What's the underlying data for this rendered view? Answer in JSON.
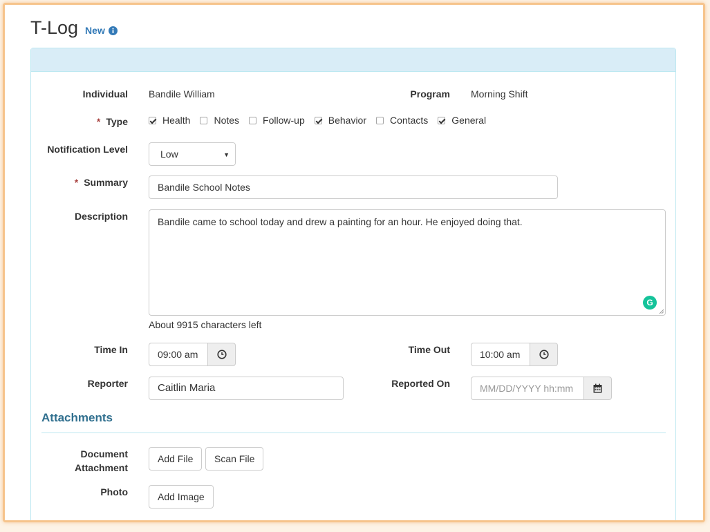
{
  "page": {
    "title": "T-Log",
    "badge": "New"
  },
  "form": {
    "individual": {
      "label": "Individual",
      "value": "Bandile William"
    },
    "program": {
      "label": "Program",
      "value": "Morning Shift"
    },
    "type": {
      "label": "Type",
      "required_mark": "*",
      "options": [
        {
          "label": "Health",
          "checked": true
        },
        {
          "label": "Notes",
          "checked": false
        },
        {
          "label": "Follow-up",
          "checked": false
        },
        {
          "label": "Behavior",
          "checked": true
        },
        {
          "label": "Contacts",
          "checked": false
        },
        {
          "label": "General",
          "checked": true
        }
      ]
    },
    "notification_level": {
      "label": "Notification Level",
      "value": "Low"
    },
    "summary": {
      "label": "Summary",
      "required_mark": "*",
      "value": "Bandile School Notes"
    },
    "description": {
      "label": "Description",
      "value": "Bandile came to school today and drew a painting for an hour. He enjoyed doing that.",
      "help": "About 9915 characters left",
      "grammarly_letter": "G"
    },
    "time_in": {
      "label": "Time In",
      "value": "09:00 am"
    },
    "time_out": {
      "label": "Time Out",
      "value": "10:00 am"
    },
    "reporter": {
      "label": "Reporter",
      "value": "Caitlin Maria"
    },
    "reported_on": {
      "label": "Reported On",
      "placeholder": "MM/DD/YYYY hh:mm"
    }
  },
  "attachments": {
    "title": "Attachments",
    "document": {
      "label_line1": "Document",
      "label_line2": "Attachment",
      "add_file": "Add File",
      "scan_file": "Scan File"
    },
    "photo": {
      "label": "Photo",
      "add_image": "Add Image"
    }
  },
  "colors": {
    "accent": "#337ab7",
    "section_title": "#31708f",
    "panel_heading": "#d9edf7",
    "required": "#a94442",
    "frame_border": "#f6c48c",
    "grammarly": "#15c39a"
  },
  "icons": {
    "badge": "info-circle-icon",
    "time": "clock-icon",
    "date": "calendar-icon",
    "grammarly": "grammarly-icon",
    "resize": "resize-grip-icon"
  }
}
